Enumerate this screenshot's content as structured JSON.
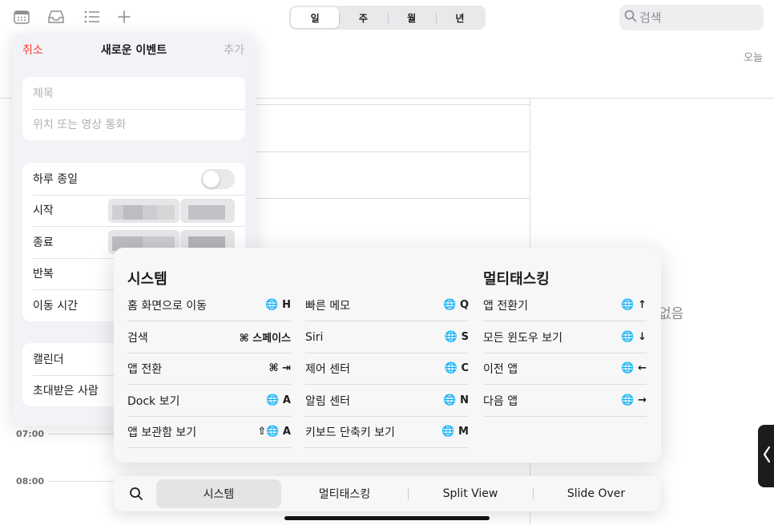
{
  "toolbar": {
    "icons": [
      "calendar-icon",
      "inbox-icon",
      "list-icon",
      "add-icon"
    ],
    "view_tabs": [
      "일",
      "주",
      "월",
      "년"
    ],
    "active_tab": "일",
    "search_placeholder": "검색",
    "today": "오늘"
  },
  "calendar": {
    "times": [
      "07:00",
      "08:00"
    ],
    "no_events_partial": "없음"
  },
  "event_form": {
    "cancel": "취소",
    "title": "새로운 이벤트",
    "add": "추가",
    "title_placeholder": "제목",
    "location_placeholder": "위치 또는 영상 통화",
    "all_day": "하루 종일",
    "all_day_on": false,
    "start": "시작",
    "end": "종료",
    "repeat": "반복",
    "travel_time": "이동 시간",
    "calendar": "캘린더",
    "invitees": "초대받은 사람"
  },
  "shortcuts": {
    "columns": [
      {
        "heading": "시스템",
        "items": [
          {
            "label": "홈 화면으로 이동",
            "key": "🌐 H"
          },
          {
            "label": "검색",
            "key": "⌘ 스페이스"
          },
          {
            "label": "앱 전환",
            "key": "⌘ ⇥"
          },
          {
            "label": "Dock 보기",
            "key": "🌐 A"
          },
          {
            "label": "앱 보관함 보기",
            "key": "⇧🌐 A"
          }
        ]
      },
      {
        "heading": "",
        "items": [
          {
            "label": "빠른 메모",
            "key": "🌐 Q"
          },
          {
            "label": "Siri",
            "key": "🌐 S"
          },
          {
            "label": "제어 센터",
            "key": "🌐 C"
          },
          {
            "label": "알림 센터",
            "key": "🌐 N"
          },
          {
            "label": "키보드 단축키 보기",
            "key": "🌐 M"
          }
        ]
      },
      {
        "heading": "멀티태스킹",
        "items": [
          {
            "label": "앱 전환기",
            "key": "🌐 ↑"
          },
          {
            "label": "모든 윈도우 보기",
            "key": "🌐 ↓"
          },
          {
            "label": "이전 앱",
            "key": "🌐 ←"
          },
          {
            "label": "다음 앱",
            "key": "🌐 →"
          }
        ]
      }
    ],
    "tabs": [
      "시스템",
      "멀티태스킹",
      "Split View",
      "Slide Over"
    ],
    "active_tab": "시스템"
  },
  "colors": {
    "accent_red": "#ff3b30",
    "background": "#ffffff",
    "panel": "#f2f2f7"
  }
}
